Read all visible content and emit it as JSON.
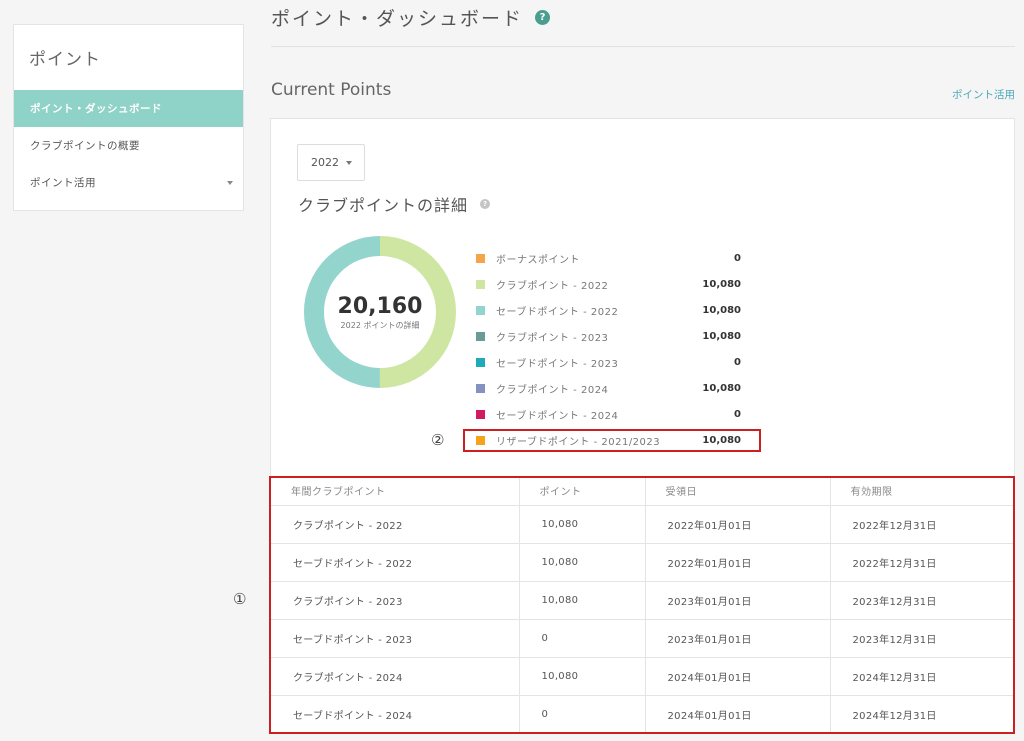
{
  "sidebar": {
    "title": "ポイント",
    "items": [
      {
        "label": "ポイント・ダッシュボード",
        "active": true
      },
      {
        "label": "クラブポイントの概要",
        "active": false
      },
      {
        "label": "ポイント活用",
        "active": false,
        "has_chevron": true
      }
    ]
  },
  "header": {
    "title": "ポイント・ダッシュボード",
    "help_glyph": "?"
  },
  "section": {
    "title": "Current Points",
    "apply_link": "ポイント活用"
  },
  "card": {
    "year_select": "2022",
    "detail_title": "クラブポイントの詳細",
    "help_glyph": "?",
    "donut": {
      "total": "20,160",
      "caption": "2022 ポイントの詳細"
    },
    "legend": [
      {
        "label": "ボーナスポイント",
        "value": "0",
        "color": "#f4a54a"
      },
      {
        "label": "クラブポイント - 2022",
        "value": "10,080",
        "color": "#cfe6a2"
      },
      {
        "label": "セーブドポイント - 2022",
        "value": "10,080",
        "color": "#93d4cc"
      },
      {
        "label": "クラブポイント - 2023",
        "value": "10,080",
        "color": "#6b9b97"
      },
      {
        "label": "セーブドポイント - 2023",
        "value": "0",
        "color": "#1eaab8"
      },
      {
        "label": "クラブポイント - 2024",
        "value": "10,080",
        "color": "#8392c1"
      },
      {
        "label": "セーブドポイント - 2024",
        "value": "0",
        "color": "#d11a5f"
      },
      {
        "label": "リザーブドポイント - 2021/2023",
        "value": "10,080",
        "color": "#f5a31a"
      }
    ],
    "markers": {
      "table": "①",
      "legend": "②"
    },
    "table": {
      "headers": [
        "年間クラブポイント",
        "ポイント",
        "受領日",
        "有効期限"
      ],
      "rows": [
        [
          "クラブポイント - 2022",
          "10,080",
          "2022年01月01日",
          "2022年12月31日"
        ],
        [
          "セーブドポイント - 2022",
          "10,080",
          "2022年01月01日",
          "2022年12月31日"
        ],
        [
          "クラブポイント - 2023",
          "10,080",
          "2023年01月01日",
          "2023年12月31日"
        ],
        [
          "セーブドポイント - 2023",
          "0",
          "2023年01月01日",
          "2023年12月31日"
        ],
        [
          "クラブポイント - 2024",
          "10,080",
          "2024年01月01日",
          "2024年12月31日"
        ],
        [
          "セーブドポイント - 2024",
          "0",
          "2024年01月01日",
          "2024年12月31日"
        ]
      ]
    }
  },
  "chart_data": {
    "type": "pie",
    "categories": [
      "クラブポイント - 2022",
      "セーブドポイント - 2022"
    ],
    "values": [
      10080,
      10080
    ],
    "colors": [
      "#cfe6a2",
      "#93d4cc"
    ],
    "style": "donut"
  }
}
